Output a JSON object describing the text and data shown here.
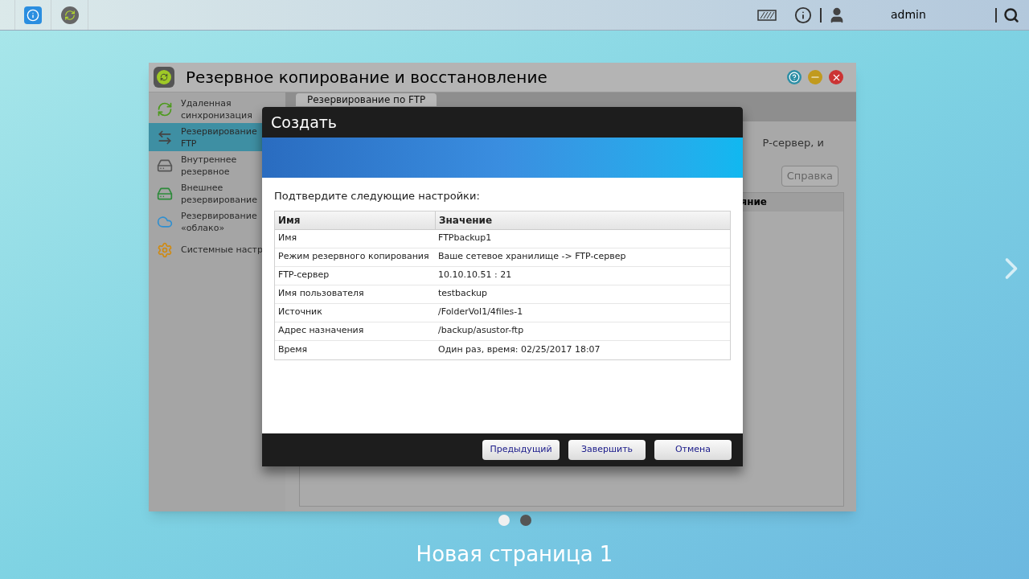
{
  "taskbar": {
    "username": "admin"
  },
  "window": {
    "title": "Резервное копирование и восстановление",
    "sidebar": {
      "items": [
        {
          "label": "Удаленная синхронизация",
          "selected": false
        },
        {
          "label": "Резервирование FTP",
          "selected": true
        },
        {
          "label": "Внутреннее резервное",
          "selected": false
        },
        {
          "label": "Внешнее резервирование",
          "selected": false
        },
        {
          "label": "Резервирование «облако»",
          "selected": false
        },
        {
          "label": "Системные настр",
          "selected": false
        }
      ]
    },
    "tab": "Резервирование по FTP",
    "description_fragment": "Р-сервер, и",
    "help_button": "Справка",
    "table_column_fragment": "яние"
  },
  "dialog": {
    "title": "Создать",
    "prompt": "Подтвердите следующие настройки:",
    "columns": [
      "Имя",
      "Значение"
    ],
    "rows": [
      {
        "name": "Имя",
        "value": "FTPbackup1"
      },
      {
        "name": "Режим резервного копирования",
        "value": "Ваше сетевое хранилище -> FTP-сервер"
      },
      {
        "name": "FTP-сервер",
        "value": "10.10.10.51 : 21"
      },
      {
        "name": "Имя пользователя",
        "value": "testbackup"
      },
      {
        "name": "Источник",
        "value": "/FolderVol1/4files-1"
      },
      {
        "name": "Адрес назначения",
        "value": "/backup/asustor-ftp"
      },
      {
        "name": "Время",
        "value": "Один раз, время: 02/25/2017 18:07"
      }
    ],
    "buttons": [
      "Предыдущий",
      "Завершить",
      "Отмена"
    ]
  },
  "pager": {
    "dots": [
      {
        "selected": true
      },
      {
        "selected": false
      }
    ],
    "page_title": "Новая страница 1"
  }
}
